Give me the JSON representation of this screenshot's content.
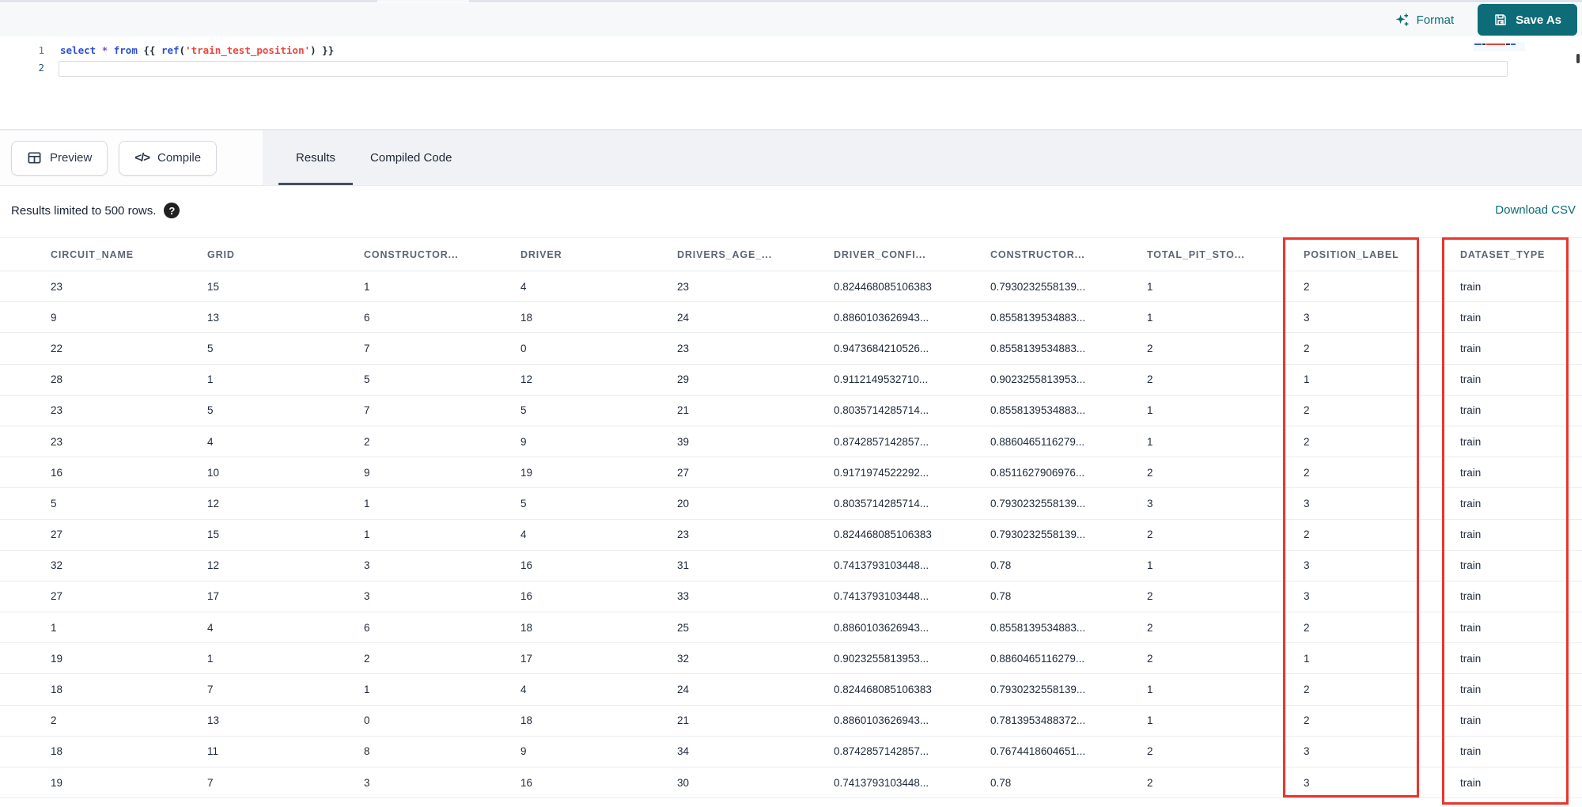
{
  "colors": {
    "accent_teal": "#0d6c77",
    "highlight_red": "#e8362d"
  },
  "toolbar": {
    "format_label": "Format",
    "save_as_label": "Save As"
  },
  "editor": {
    "line_numbers": [
      "1",
      "2"
    ],
    "code_tokens": [
      {
        "text": "select",
        "type": "keyword"
      },
      {
        "text": " ",
        "type": "plain"
      },
      {
        "text": "*",
        "type": "operator"
      },
      {
        "text": " ",
        "type": "plain"
      },
      {
        "text": "from",
        "type": "keyword"
      },
      {
        "text": " {{ ",
        "type": "plain"
      },
      {
        "text": "ref",
        "type": "function"
      },
      {
        "text": "(",
        "type": "plain"
      },
      {
        "text": "'train_test_position'",
        "type": "string"
      },
      {
        "text": ")",
        "type": "plain"
      },
      {
        "text": " }}",
        "type": "plain"
      }
    ]
  },
  "actionbar": {
    "preview_label": "Preview",
    "compile_label": "Compile",
    "tabs": [
      {
        "label": "Results",
        "active": true
      },
      {
        "label": "Compiled Code",
        "active": false
      }
    ]
  },
  "results": {
    "limit_note": "Results limited to 500 rows.",
    "help_glyph": "?",
    "download_label": "Download CSV",
    "columns": [
      "CIRCUIT_NAME",
      "GRID",
      "CONSTRUCTOR...",
      "DRIVER",
      "DRIVERS_AGE_...",
      "DRIVER_CONFI...",
      "CONSTRUCTOR...",
      "TOTAL_PIT_STO...",
      "POSITION_LABEL",
      "DATASET_TYPE"
    ],
    "highlighted_columns": [
      "POSITION_LABEL",
      "DATASET_TYPE"
    ],
    "rows": [
      [
        "23",
        "15",
        "1",
        "4",
        "23",
        "0.824468085106383",
        "0.7930232558139...",
        "1",
        "2",
        "train"
      ],
      [
        "9",
        "13",
        "6",
        "18",
        "24",
        "0.8860103626943...",
        "0.8558139534883...",
        "1",
        "3",
        "train"
      ],
      [
        "22",
        "5",
        "7",
        "0",
        "23",
        "0.9473684210526...",
        "0.8558139534883...",
        "2",
        "2",
        "train"
      ],
      [
        "28",
        "1",
        "5",
        "12",
        "29",
        "0.9112149532710...",
        "0.9023255813953...",
        "2",
        "1",
        "train"
      ],
      [
        "23",
        "5",
        "7",
        "5",
        "21",
        "0.8035714285714...",
        "0.8558139534883...",
        "1",
        "2",
        "train"
      ],
      [
        "23",
        "4",
        "2",
        "9",
        "39",
        "0.8742857142857...",
        "0.8860465116279...",
        "1",
        "2",
        "train"
      ],
      [
        "16",
        "10",
        "9",
        "19",
        "27",
        "0.9171974522292...",
        "0.8511627906976...",
        "2",
        "2",
        "train"
      ],
      [
        "5",
        "12",
        "1",
        "5",
        "20",
        "0.8035714285714...",
        "0.7930232558139...",
        "3",
        "3",
        "train"
      ],
      [
        "27",
        "15",
        "1",
        "4",
        "23",
        "0.824468085106383",
        "0.7930232558139...",
        "2",
        "2",
        "train"
      ],
      [
        "32",
        "12",
        "3",
        "16",
        "31",
        "0.7413793103448...",
        "0.78",
        "1",
        "3",
        "train"
      ],
      [
        "27",
        "17",
        "3",
        "16",
        "33",
        "0.7413793103448...",
        "0.78",
        "2",
        "3",
        "train"
      ],
      [
        "1",
        "4",
        "6",
        "18",
        "25",
        "0.8860103626943...",
        "0.8558139534883...",
        "2",
        "2",
        "train"
      ],
      [
        "19",
        "1",
        "2",
        "17",
        "32",
        "0.9023255813953...",
        "0.8860465116279...",
        "2",
        "1",
        "train"
      ],
      [
        "18",
        "7",
        "1",
        "4",
        "24",
        "0.824468085106383",
        "0.7930232558139...",
        "1",
        "2",
        "train"
      ],
      [
        "2",
        "13",
        "0",
        "18",
        "21",
        "0.8860103626943...",
        "0.7813953488372...",
        "1",
        "2",
        "train"
      ],
      [
        "18",
        "11",
        "8",
        "9",
        "34",
        "0.8742857142857...",
        "0.7674418604651...",
        "2",
        "3",
        "train"
      ],
      [
        "19",
        "7",
        "3",
        "16",
        "30",
        "0.7413793103448...",
        "0.78",
        "2",
        "3",
        "train"
      ]
    ]
  }
}
